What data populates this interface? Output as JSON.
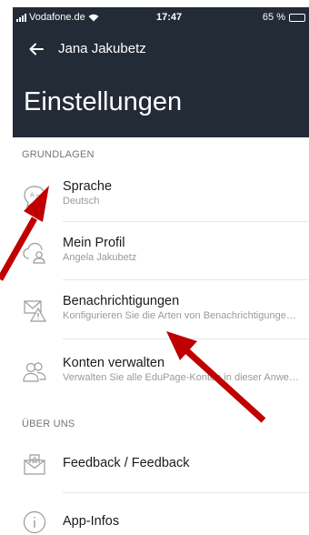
{
  "status_bar": {
    "carrier": "Vodafone.de",
    "time": "17:47",
    "battery": "65 %",
    "battery_level": 0.65
  },
  "header": {
    "back_label": "Jana Jakubetz",
    "page_title": "Einstellungen"
  },
  "sections": {
    "basics": {
      "label": "GRUNDLAGEN",
      "items": [
        {
          "title": "Sprache",
          "subtitle": "Deutsch",
          "icon": "language-icon"
        },
        {
          "title": "Mein Profil",
          "subtitle": "Angela Jakubetz",
          "icon": "profile-cloud-icon"
        },
        {
          "title": "Benachrichtigungen",
          "subtitle": "Konfigurieren Sie die Arten von Benachrichtigunge…",
          "icon": "notification-warning-icon"
        },
        {
          "title": "Konten verwalten",
          "subtitle": "Verwalten Sie alle EduPage-Konten in dieser Anwe…",
          "icon": "accounts-icon"
        }
      ]
    },
    "about": {
      "label": "ÜBER UNS",
      "items": [
        {
          "title": "Feedback / Feedback",
          "icon": "feedback-icon"
        },
        {
          "title": "App-Infos",
          "icon": "info-icon"
        }
      ]
    }
  },
  "annotation_color": "#c00000"
}
